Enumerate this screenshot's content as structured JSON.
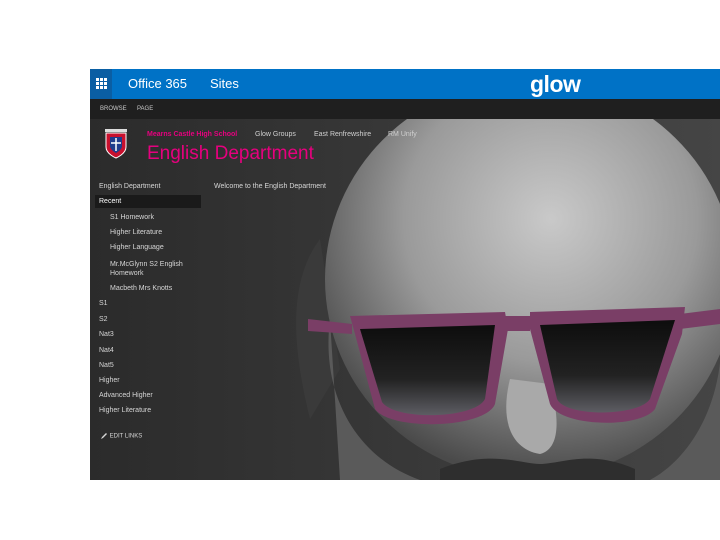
{
  "topbar": {
    "app_name": "Office 365",
    "sites_label": "Sites",
    "brand": "glow"
  },
  "ribbon": {
    "tabs": [
      "BROWSE",
      "PAGE"
    ]
  },
  "header": {
    "links": [
      "Mearns Castle High School",
      "Glow Groups",
      "East Renfrewshire",
      "RM Unify"
    ],
    "site_title": "English Department"
  },
  "quicklaunch": {
    "root": "English Department",
    "recent_label": "Recent",
    "recent_items": [
      "S1 Homework",
      "Higher Literature",
      "Higher Language",
      "Mr.McGlynn S2 English Homework",
      "Macbeth Mrs Knotts"
    ],
    "items": [
      "S1",
      "S2",
      "Nat3",
      "Nat4",
      "Nat5",
      "Higher",
      "Advanced Higher",
      "Higher Literature"
    ],
    "edit_links": "EDIT LINKS"
  },
  "content": {
    "welcome": "Welcome to the English Department"
  },
  "colors": {
    "suite_bar": "#0072c6",
    "accent": "#e6007e",
    "sunglasses": "#7a3e66"
  }
}
